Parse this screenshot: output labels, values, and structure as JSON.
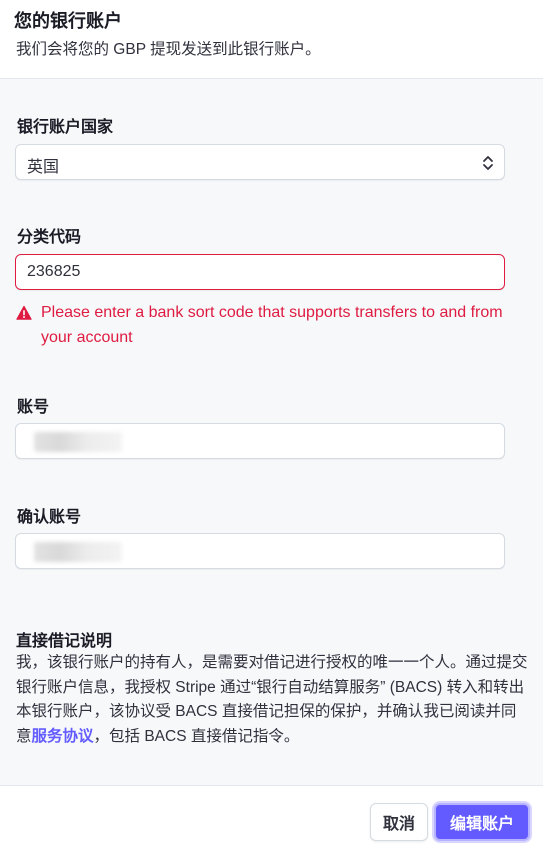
{
  "header": {
    "title": "您的银行账户",
    "subtitle": "我们会将您的 GBP 提现发送到此银行账户。"
  },
  "country": {
    "label": "银行账户国家",
    "selected": "英国"
  },
  "sort_code": {
    "label": "分类代码",
    "value": "236825",
    "error": "Please enter a bank sort code that supports transfers to and from your account"
  },
  "account_number": {
    "label": "账号"
  },
  "confirm_account_number": {
    "label": "确认账号"
  },
  "mandate": {
    "title": "直接借记说明",
    "text_before": "我，该银行账户的持有人，是需要对借记进行授权的唯一一个人。通过提交银行账户信息，我授权 Stripe 通过“银行自动结算服务” (BACS) 转入和转出本银行账户，该协议受 BACS 直接借记担保的保护，并确认我已阅读并同意",
    "link": "服务协议",
    "text_after": "，包括 BACS 直接借记指令。"
  },
  "footer": {
    "cancel_label": "取消",
    "primary_label": "编辑账户"
  },
  "colors": {
    "accent": "#635bff",
    "error": "#df1b41"
  },
  "icons": {
    "select": "chevron-up-down-icon",
    "error": "warning-triangle-icon"
  }
}
